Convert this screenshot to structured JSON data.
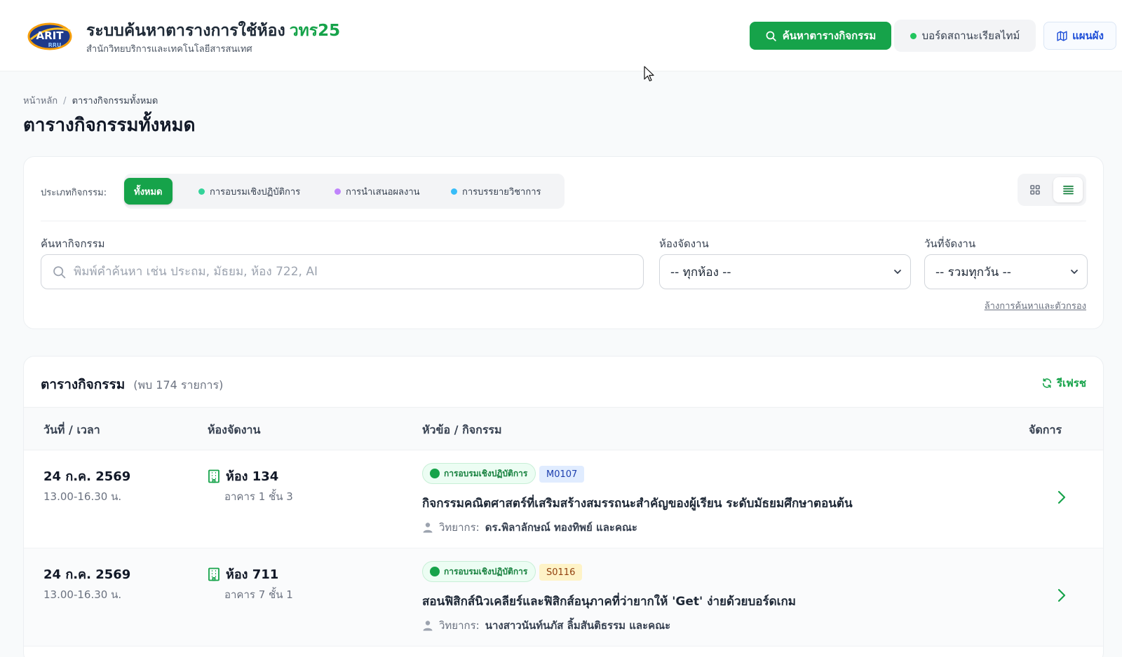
{
  "header": {
    "logo_text": "ARIT RRU",
    "title": "ระบบค้นหาตารางการใช้ห้อง",
    "title_accent": "วทร25",
    "subtitle": "สำนักวิทยบริการและเทคโนโลยีสารสนเทศ",
    "search_schedule_label": "ค้นหาตารางกิจกรรม",
    "status_board_label": "บอร์ดสถานะเรียลไทม์",
    "map_label": "แผนผัง"
  },
  "breadcrumb": {
    "home": "หน้าหลัก",
    "separator": "/",
    "current": "ตารางกิจกรรมทั้งหมด"
  },
  "page_title": "ตารางกิจกรรมทั้งหมด",
  "filters": {
    "type_label": "ประเภทกิจกรรม:",
    "types": [
      {
        "label": "ทั้งหมด",
        "active": true
      },
      {
        "label": "การอบรมเชิงปฏิบัติการ",
        "dot_color": "#34d399"
      },
      {
        "label": "การนำเสนอผลงาน",
        "dot_color": "#c084fc"
      },
      {
        "label": "การบรรยายวิชาการ",
        "dot_color": "#38bdf8"
      }
    ],
    "view_modes": [
      "grid-icon",
      "list-icon"
    ],
    "active_view": "list",
    "search_label": "ค้นหากิจกรรม",
    "search_placeholder": "พิมพ์คำค้นหา เช่น ประถม, มัธยม, ห้อง 722, AI",
    "search_value": "",
    "room_label": "ห้องจัดงาน",
    "room_selected": "-- ทุกห้อง --",
    "date_label": "วันที่จัดงาน",
    "date_selected": "-- รวมทุกวัน --",
    "clear_label": "ล้างการค้นหาและตัวกรอง"
  },
  "table": {
    "title": "ตารางกิจกรรม",
    "count_text": "(พบ 174 รายการ)",
    "refresh_label": "รีเฟรช",
    "columns": [
      "วันที่ / เวลา",
      "ห้องจัดงาน",
      "หัวข้อ / กิจกรรม",
      "จัดการ"
    ],
    "rows": [
      {
        "date": "24 ก.ค. 2569",
        "time": "13.00-16.30 น.",
        "room": "ห้อง 134",
        "building": "อาคาร 1 ชั้น 3",
        "type": "การอบรมเชิงปฏิบัติการ",
        "code": "M0107",
        "code_color": "blue",
        "topic": "กิจกรรมคณิตศาสตร์ที่เสริมสร้างสมรรถนะสำคัญของผู้เรียน ระดับมัธยมศึกษาตอนต้น",
        "speaker_label": "วิทยากร:",
        "speaker": "ดร.พิลาลักษณ์ ทองทิพย์ และคณะ"
      },
      {
        "date": "24 ก.ค. 2569",
        "time": "13.00-16.30 น.",
        "room": "ห้อง 711",
        "building": "อาคาร 7 ชั้น 1",
        "type": "การอบรมเชิงปฏิบัติการ",
        "code": "S0116",
        "code_color": "yellow",
        "topic": "สอนฟิสิกส์นิวเคลียร์และฟิสิกส์อนุภาคที่ว่ายากให้ 'Get' ง่ายด้วยบอร์ดเกม",
        "speaker_label": "วิทยากร:",
        "speaker": "นางสาวนันท์นภัส ลิ้มสันติธรรม และคณะ"
      }
    ]
  },
  "colors": {
    "primary": "#16a34a",
    "link_blue": "#1d4ed8"
  }
}
